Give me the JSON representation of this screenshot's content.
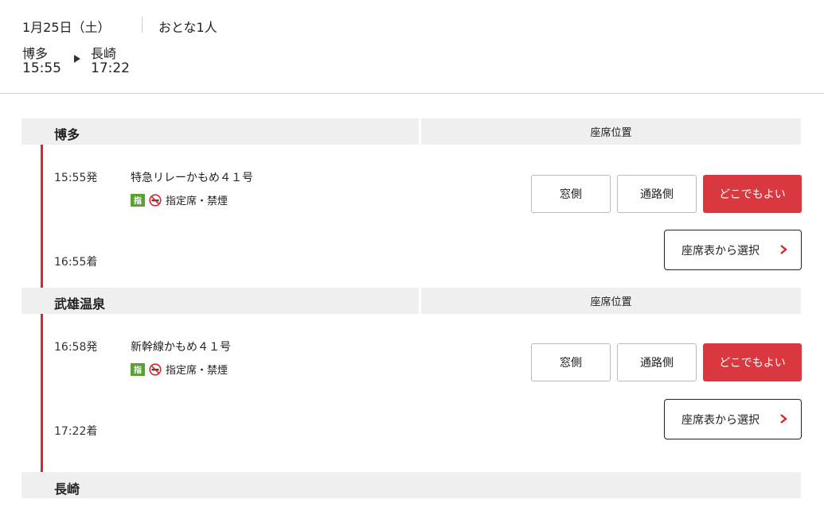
{
  "header": {
    "date": "1月25日（土）",
    "passengers": "おとな1人",
    "from": {
      "station": "博多",
      "time": "15:55"
    },
    "to": {
      "station": "長崎",
      "time": "17:22"
    }
  },
  "seat_position_label": "座席位置",
  "stations": [
    "博多",
    "武雄温泉",
    "長崎"
  ],
  "legs": [
    {
      "dep": "15:55発",
      "arr": "16:55着",
      "train": "特急リレーかもめ４１号",
      "seat_type_icon": "指",
      "seat_info": "指定席・禁煙",
      "options": [
        "窓側",
        "通路側",
        "どこでもよい"
      ],
      "selected": "どこでもよい",
      "seat_map_label": "座席表から選択"
    },
    {
      "dep": "16:58発",
      "arr": "17:22着",
      "train": "新幹線かもめ４１号",
      "seat_type_icon": "指",
      "seat_info": "指定席・禁煙",
      "options": [
        "窓側",
        "通路側",
        "どこでもよい"
      ],
      "selected": "どこでもよい",
      "seat_map_label": "座席表から選択"
    }
  ],
  "colors": {
    "accent": "#d9383e",
    "timeline": "#d9262c",
    "reserved_icon": "#5aa134"
  }
}
